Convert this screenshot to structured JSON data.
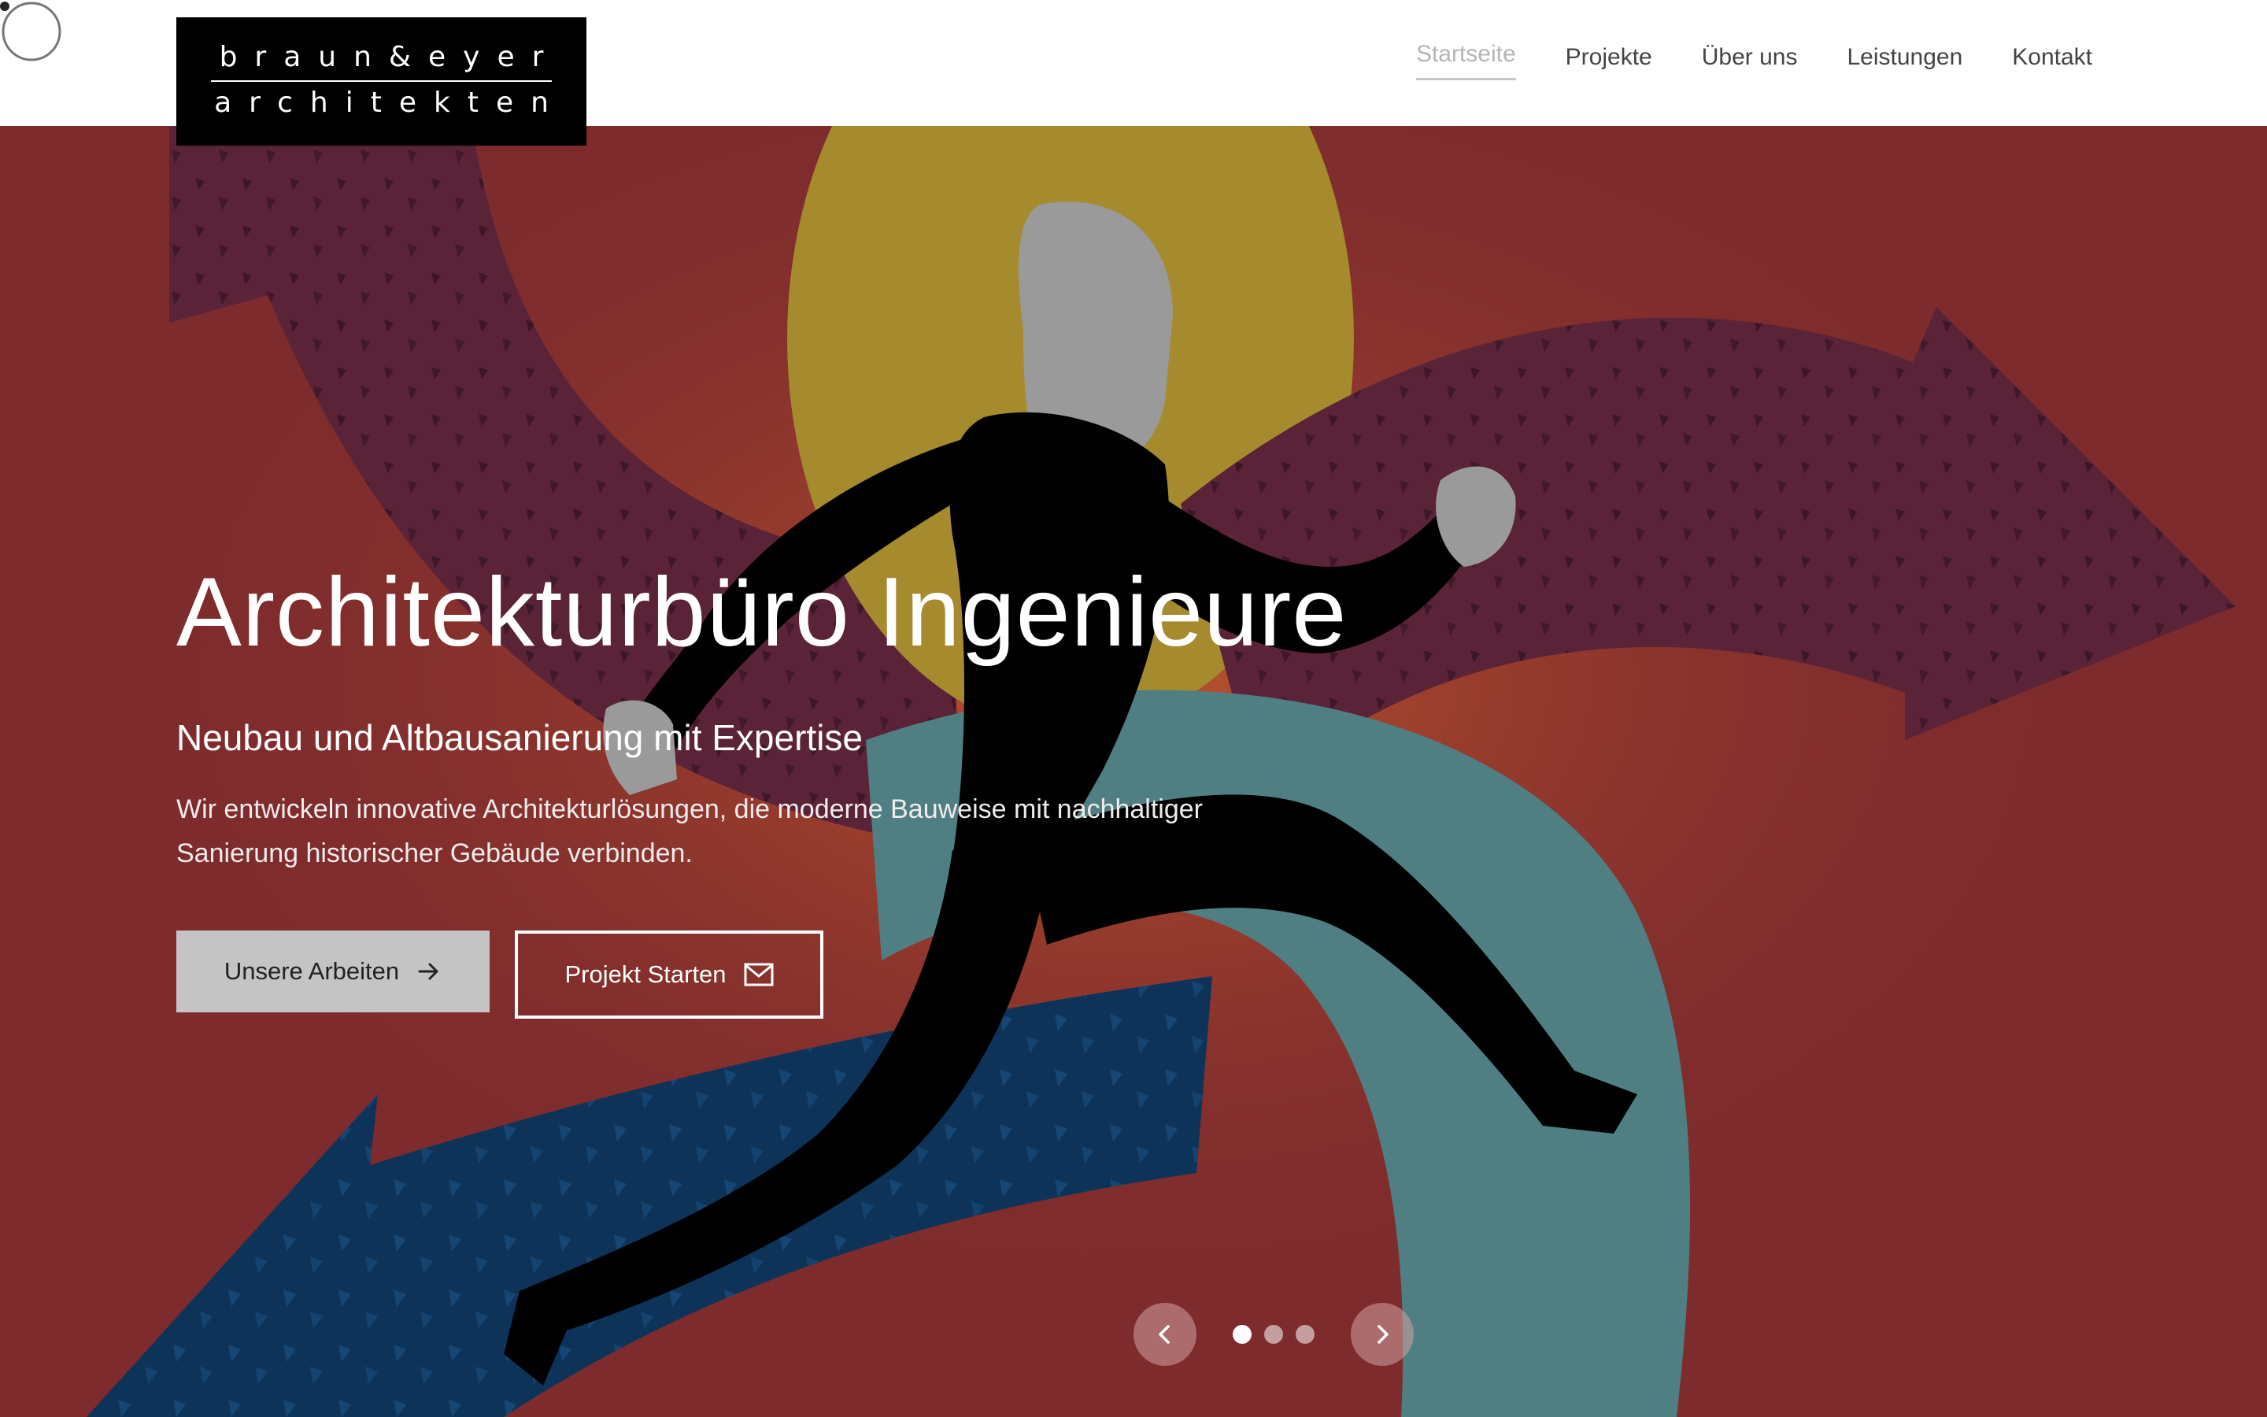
{
  "logo": {
    "line1": "braun&eyer",
    "line2": "architekten"
  },
  "nav": {
    "items": [
      {
        "label": "Startseite",
        "active": true
      },
      {
        "label": "Projekte",
        "active": false
      },
      {
        "label": "Über uns",
        "active": false
      },
      {
        "label": "Leistungen",
        "active": false
      },
      {
        "label": "Kontakt",
        "active": false
      }
    ]
  },
  "hero": {
    "title": "Architekturbüro Ingenieure",
    "subtitle": "Neubau und Altbausanierung mit Expertise",
    "text": "Wir entwickeln innovative Architekturlösungen, die moderne Bauweise mit nachhaltiger Sanierung historischer Gebäude verbinden.",
    "primary_button": {
      "label": "Unsere Arbeiten",
      "icon": "arrow-right-icon"
    },
    "secondary_button": {
      "label": "Projekt Starten",
      "icon": "mail-icon"
    }
  },
  "slider": {
    "slide_count": 3,
    "active_index": 0
  },
  "colors": {
    "hero_background": "#7e2b2d",
    "purple_arrow": "#5a2338",
    "mustard_circle": "#a68a2e",
    "teal_shape": "#4f7f83",
    "navy_arrow": "#0d3358",
    "orange_glow": "#b8522c",
    "figure": "#000000",
    "skin": "#9a9a9a"
  }
}
